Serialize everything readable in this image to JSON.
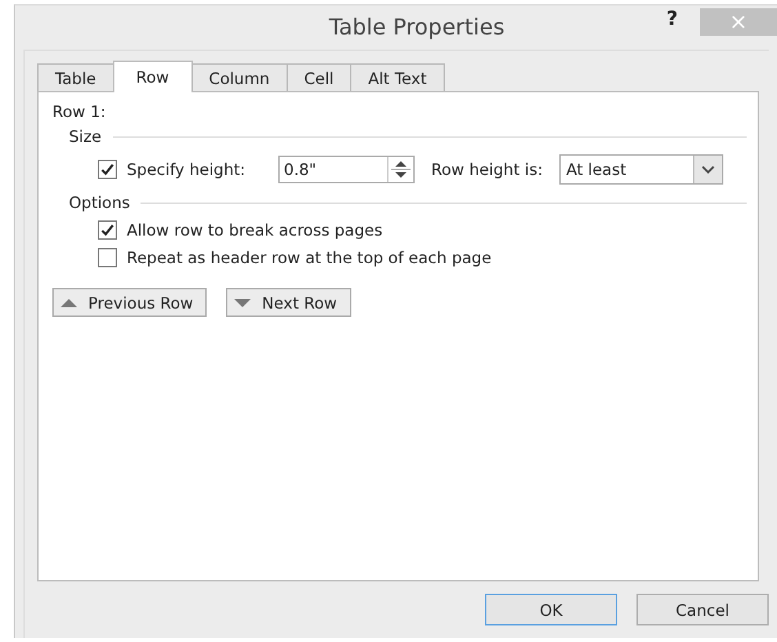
{
  "window": {
    "title": "Table Properties",
    "help": "?",
    "close": "×"
  },
  "tabs": [
    {
      "label": "Table",
      "selected": false
    },
    {
      "label": "Row",
      "selected": true
    },
    {
      "label": "Column",
      "selected": false
    },
    {
      "label": "Cell",
      "selected": false
    },
    {
      "label": "Alt Text",
      "selected": false
    }
  ],
  "row_label": "Row 1:",
  "size": {
    "heading": "Size",
    "specify_height": {
      "label": "Specify height:",
      "checked": true
    },
    "height_value": "0.8\"",
    "row_height_is": {
      "label": "Row height is:",
      "value": "At least"
    }
  },
  "options": {
    "heading": "Options",
    "items": [
      {
        "label": "Allow row to break across pages",
        "checked": true
      },
      {
        "label": "Repeat as header row at the top of each page",
        "checked": false
      }
    ]
  },
  "nav_buttons": [
    {
      "label": "Previous Row",
      "kind": "up"
    },
    {
      "label": "Next Row",
      "kind": "down"
    }
  ],
  "buttons": [
    {
      "label": "OK",
      "default": true
    },
    {
      "label": "Cancel",
      "default": false
    }
  ]
}
